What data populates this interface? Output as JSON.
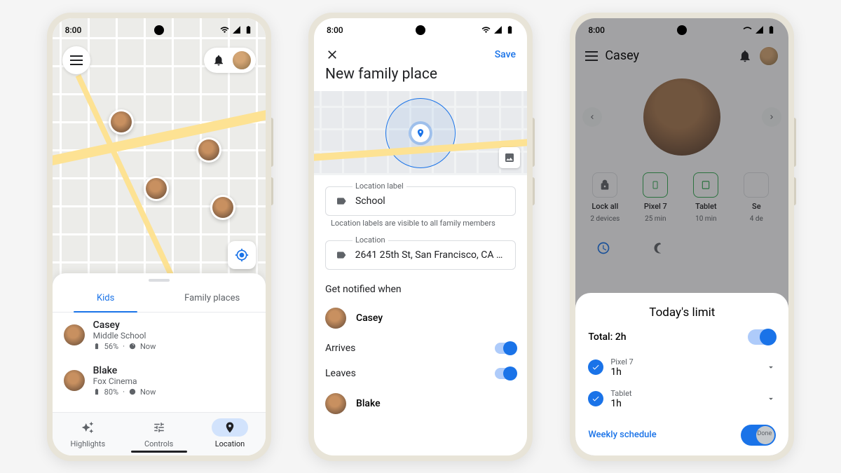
{
  "status_time": "8:00",
  "phone1": {
    "tabs": {
      "kids": "Kids",
      "places": "Family places"
    },
    "kids": [
      {
        "name": "Casey",
        "place": "Middle School",
        "battery": "56%",
        "signal": "Now"
      },
      {
        "name": "Blake",
        "place": "Fox Cinema",
        "battery": "80%",
        "signal": "Now"
      }
    ],
    "nav": {
      "highlights": "Highlights",
      "controls": "Controls",
      "location": "Location"
    }
  },
  "phone2": {
    "title": "New family place",
    "save": "Save",
    "label_field": {
      "label": "Location label",
      "value": "School"
    },
    "helper": "Location labels are visible to all family members",
    "location_field": {
      "label": "Location",
      "value": "2641 25th St, San Francisco, CA 9…"
    },
    "notify_header": "Get notified when",
    "people": [
      {
        "name": "Casey",
        "arrives_label": "Arrives",
        "leaves_label": "Leaves"
      },
      {
        "name": "Blake"
      }
    ]
  },
  "phone3": {
    "child_name": "Casey",
    "devices": [
      {
        "name": "Lock all",
        "sub": "2 devices",
        "style": "grey",
        "icon": "lock"
      },
      {
        "name": "Pixel 7",
        "sub": "25 min",
        "style": "green",
        "icon": "phone"
      },
      {
        "name": "Tablet",
        "sub": "10 min",
        "style": "green",
        "icon": "tablet"
      },
      {
        "name": "Se",
        "sub": "4 de",
        "style": "grey",
        "icon": "dots"
      }
    ],
    "sheet": {
      "title": "Today's limit",
      "total_label": "Total: 2h",
      "limits": [
        {
          "name": "Pixel 7",
          "value": "1h"
        },
        {
          "name": "Tablet",
          "value": "1h"
        }
      ],
      "weekly": "Weekly schedule",
      "done": "Done"
    }
  }
}
